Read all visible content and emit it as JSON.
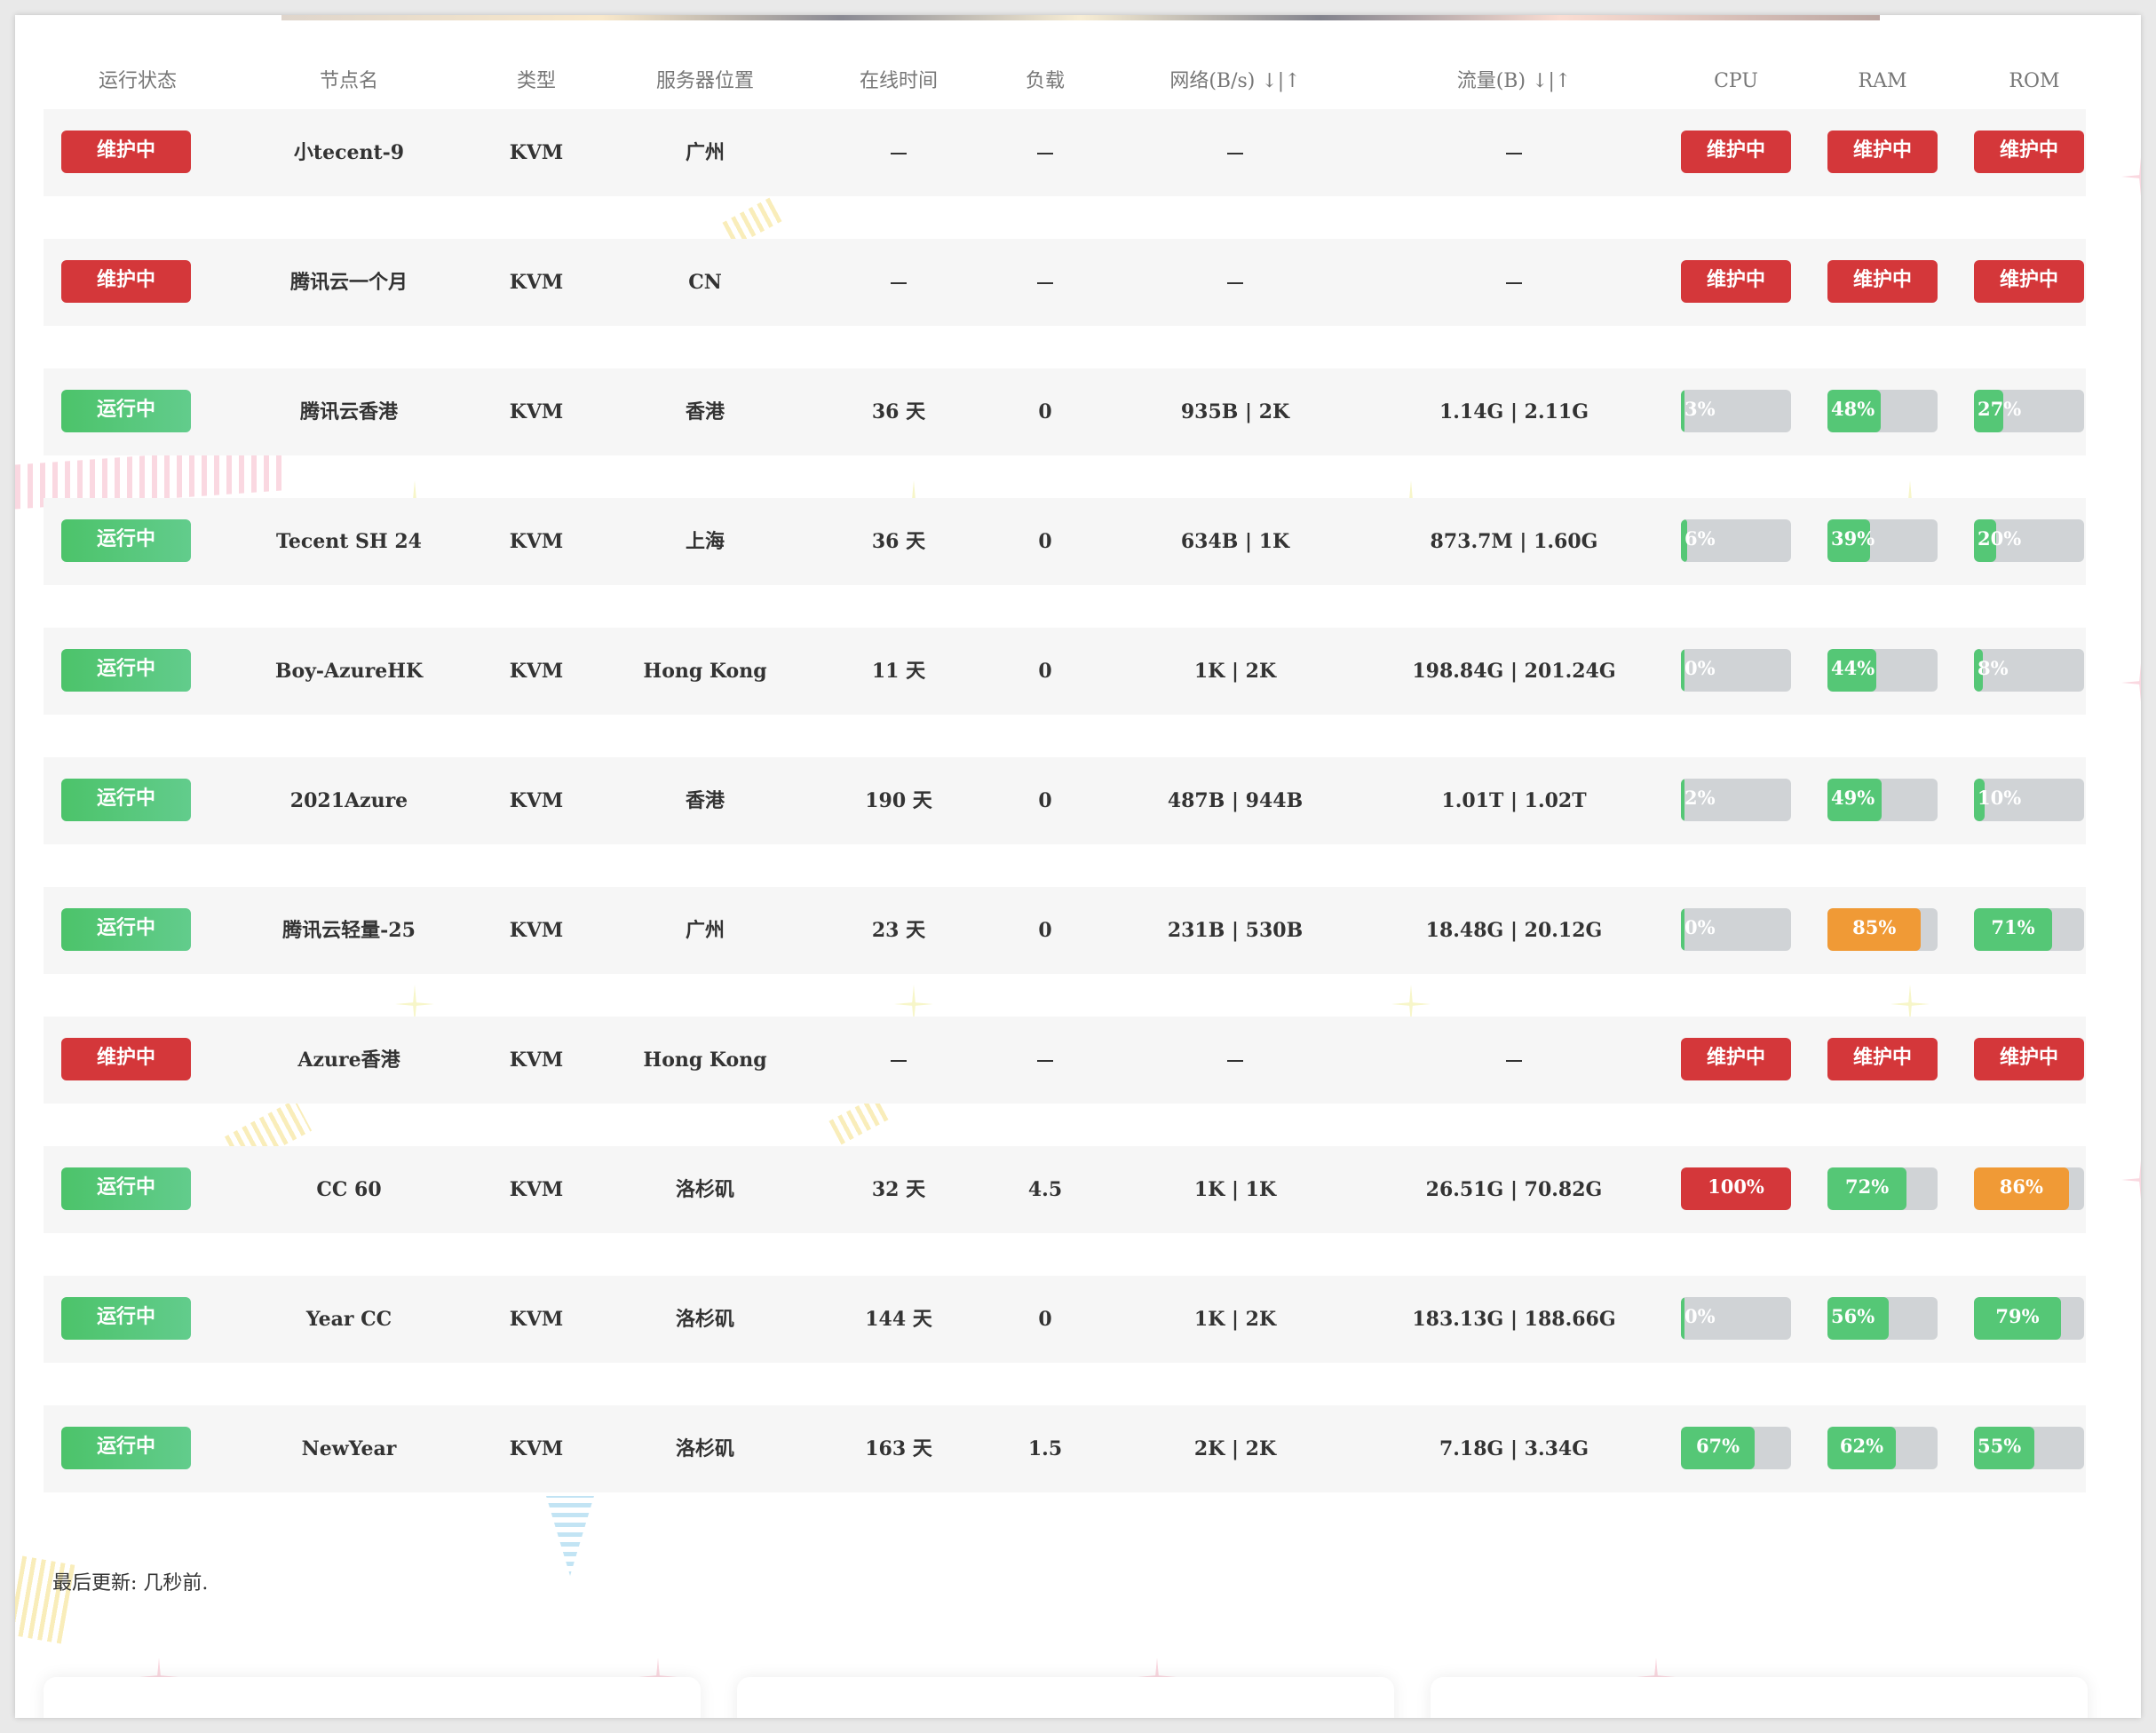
{
  "headers": {
    "status": "运行状态",
    "name": "节点名",
    "type": "类型",
    "location": "服务器位置",
    "uptime": "在线时间",
    "load": "负载",
    "network": "网络(B/s) ↓|↑",
    "traffic": "流量(B) ↓|↑",
    "cpu": "CPU",
    "ram": "RAM",
    "rom": "ROM"
  },
  "rows": [
    {
      "status": "维护中",
      "online": false,
      "name": "小tecent-9",
      "type": "KVM",
      "location": "广州",
      "uptime": "",
      "load": "",
      "network": "",
      "traffic": "",
      "cpu": "维护中",
      "ram": "维护中",
      "rom": "维护中"
    },
    {
      "status": "维护中",
      "online": false,
      "name": "腾讯云一个月",
      "type": "KVM",
      "location": "CN",
      "uptime": "",
      "load": "",
      "network": "",
      "traffic": "",
      "cpu": "维护中",
      "ram": "维护中",
      "rom": "维护中"
    },
    {
      "status": "运行中",
      "online": true,
      "name": "腾讯云香港",
      "type": "KVM",
      "location": "香港",
      "uptime": "36 天",
      "load": "0",
      "network": "935B | 2K",
      "traffic": "1.14G | 2.11G",
      "cpu": "3%",
      "ram": "48%",
      "rom": "27%",
      "cpu_v": 3,
      "ram_v": 48,
      "rom_v": 27
    },
    {
      "status": "运行中",
      "online": true,
      "name": "Tecent SH 24",
      "type": "KVM",
      "location": "上海",
      "uptime": "36 天",
      "load": "0",
      "network": "634B | 1K",
      "traffic": "873.7M | 1.60G",
      "cpu": "6%",
      "ram": "39%",
      "rom": "20%",
      "cpu_v": 6,
      "ram_v": 39,
      "rom_v": 20
    },
    {
      "status": "运行中",
      "online": true,
      "name": "Boy-AzureHK",
      "type": "KVM",
      "location": "Hong Kong",
      "uptime": "11 天",
      "load": "0",
      "network": "1K | 2K",
      "traffic": "198.84G | 201.24G",
      "cpu": "0%",
      "ram": "44%",
      "rom": "8%",
      "cpu_v": 0,
      "ram_v": 44,
      "rom_v": 8
    },
    {
      "status": "运行中",
      "online": true,
      "name": "2021Azure",
      "type": "KVM",
      "location": "香港",
      "uptime": "190 天",
      "load": "0",
      "network": "487B | 944B",
      "traffic": "1.01T | 1.02T",
      "cpu": "2%",
      "ram": "49%",
      "rom": "10%",
      "cpu_v": 2,
      "ram_v": 49,
      "rom_v": 10
    },
    {
      "status": "运行中",
      "online": true,
      "name": "腾讯云轻量-25",
      "type": "KVM",
      "location": "广州",
      "uptime": "23 天",
      "load": "0",
      "network": "231B | 530B",
      "traffic": "18.48G | 20.12G",
      "cpu": "0%",
      "ram": "85%",
      "rom": "71%",
      "cpu_v": 0,
      "ram_v": 85,
      "rom_v": 71
    },
    {
      "status": "维护中",
      "online": false,
      "name": "Azure香港",
      "type": "KVM",
      "location": "Hong Kong",
      "uptime": "",
      "load": "",
      "network": "",
      "traffic": "",
      "cpu": "维护中",
      "ram": "维护中",
      "rom": "维护中"
    },
    {
      "status": "运行中",
      "online": true,
      "name": "CC 60",
      "type": "KVM",
      "location": "洛杉矶",
      "uptime": "32 天",
      "load": "4.5",
      "network": "1K | 1K",
      "traffic": "26.51G | 70.82G",
      "cpu": "100%",
      "ram": "72%",
      "rom": "86%",
      "cpu_v": 100,
      "ram_v": 72,
      "rom_v": 86
    },
    {
      "status": "运行中",
      "online": true,
      "name": "Year CC",
      "type": "KVM",
      "location": "洛杉矶",
      "uptime": "144 天",
      "load": "0",
      "network": "1K | 2K",
      "traffic": "183.13G | 188.66G",
      "cpu": "0%",
      "ram": "56%",
      "rom": "79%",
      "cpu_v": 0,
      "ram_v": 56,
      "rom_v": 79
    },
    {
      "status": "运行中",
      "online": true,
      "name": "NewYear",
      "type": "KVM",
      "location": "洛杉矶",
      "uptime": "163 天",
      "load": "1.5",
      "network": "2K | 2K",
      "traffic": "7.18G | 3.34G",
      "cpu": "67%",
      "ram": "62%",
      "rom": "55%",
      "cpu_v": 67,
      "ram_v": 62,
      "rom_v": 55
    }
  ],
  "footer": {
    "last_update": "最后更新: 几秒前."
  },
  "colors": {
    "running": "#4cc36a",
    "maintenance": "#d4373a",
    "warn": "#f09a36",
    "track": "#d0d3d6",
    "row_bg": "#f6f6f6"
  }
}
